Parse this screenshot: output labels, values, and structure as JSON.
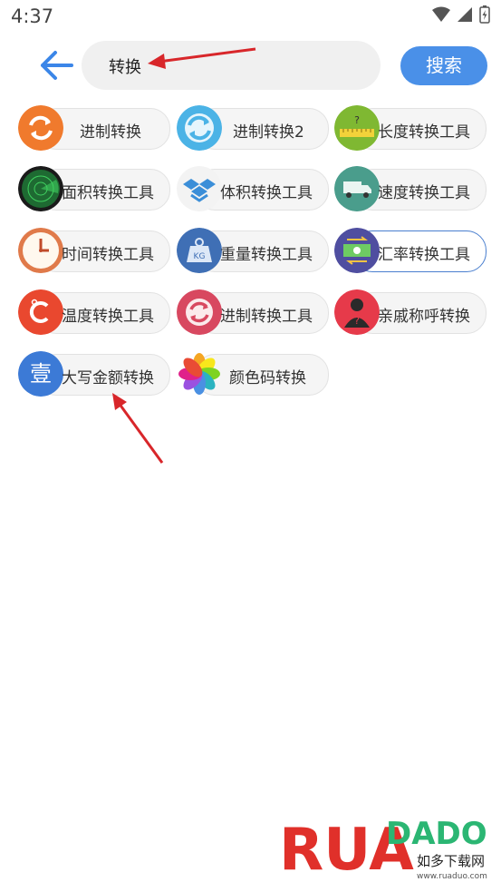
{
  "status_bar": {
    "time": "4:37"
  },
  "search": {
    "query": "转换",
    "button_label": "搜索"
  },
  "tools": [
    {
      "label": "进制转换",
      "icon": "refresh-orange-icon",
      "color": "#f07a2d"
    },
    {
      "label": "进制转换2",
      "icon": "refresh-blue-icon",
      "color": "#4bb3e6"
    },
    {
      "label": "长度转换工具",
      "icon": "ruler-icon",
      "color": "#7fb832"
    },
    {
      "label": "面积转换工具",
      "icon": "radar-icon",
      "color": "#1e6a32"
    },
    {
      "label": "体积转换工具",
      "icon": "box-icon",
      "color": "#3b8ed8"
    },
    {
      "label": "速度转换工具",
      "icon": "truck-icon",
      "color": "#4a9d8c"
    },
    {
      "label": "时间转换工具",
      "icon": "clock-icon",
      "color": "#e07a4a"
    },
    {
      "label": "重量转换工具",
      "icon": "weight-icon",
      "color": "#3f6fb5"
    },
    {
      "label": "汇率转换工具",
      "icon": "money-icon",
      "color": "#4f4ea0"
    },
    {
      "label": "温度转换工具",
      "icon": "thermometer-icon",
      "color": "#e9482f"
    },
    {
      "label": "进制转换工具",
      "icon": "cycle-icon",
      "color": "#d84860"
    },
    {
      "label": "亲戚称呼转换",
      "icon": "person-question-icon",
      "color": "#e63a4a"
    },
    {
      "label": "大写金额转换",
      "icon": "chinese-numeral-icon",
      "color": "#3c7ad6"
    },
    {
      "label": "颜色码转换",
      "icon": "color-petals-icon",
      "color": "#f5a623"
    }
  ],
  "watermark": {
    "brand": "RUADADO",
    "subtitle": "如多下载网",
    "url": "www.ruaduo.com"
  }
}
